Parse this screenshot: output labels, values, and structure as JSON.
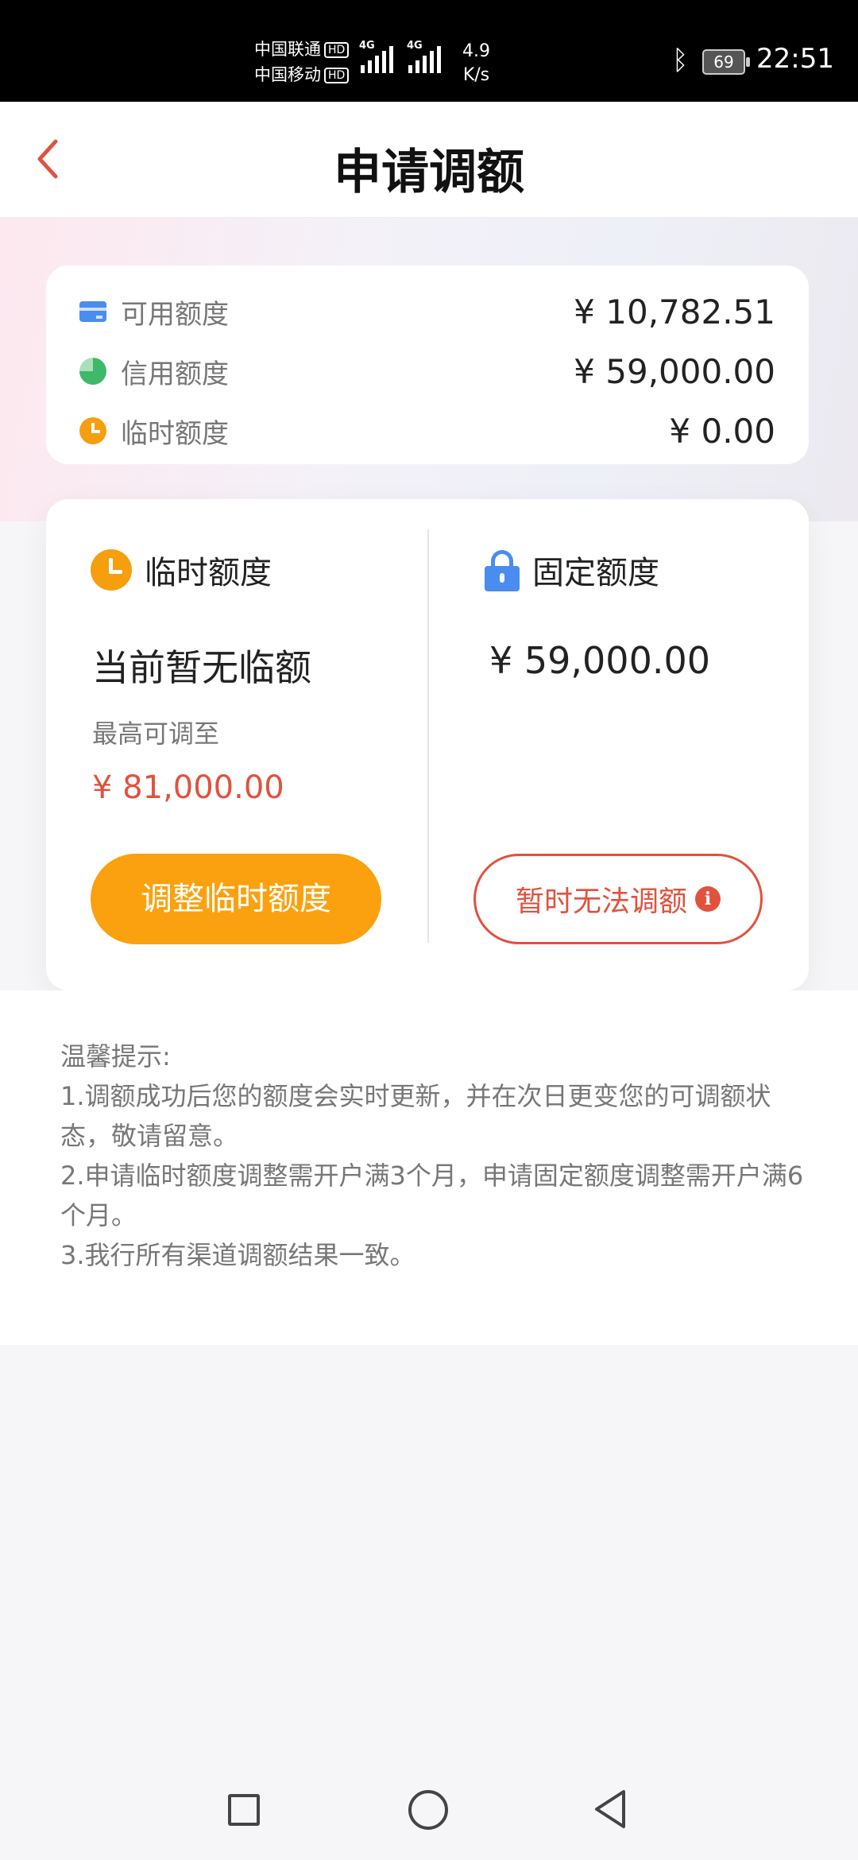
{
  "status_bar": {
    "carrier1": "中国联通",
    "carrier2": "中国移动",
    "hd": "HD",
    "network": "4G",
    "speed_value": "4.9",
    "speed_unit": "K/s",
    "battery": "69",
    "time": "22:51"
  },
  "header": {
    "title": "申请调额"
  },
  "summary": {
    "rows": [
      {
        "label": "可用额度",
        "value": "¥ 10,782.51",
        "icon": "card-icon"
      },
      {
        "label": "信用额度",
        "value": "¥ 59,000.00",
        "icon": "pie-chart-icon"
      },
      {
        "label": "临时额度",
        "value": "¥ 0.00",
        "icon": "clock-icon"
      }
    ]
  },
  "temp": {
    "heading": "临时额度",
    "status": "当前暂无临额",
    "max_label": "最高可调至",
    "max_value": "¥ 81,000.00",
    "button": "调整临时额度"
  },
  "fixed": {
    "heading": "固定额度",
    "amount": "¥ 59,000.00",
    "button": "暂时无法调额",
    "info": "i"
  },
  "tips": {
    "title": "温馨提示:",
    "items": [
      "1.调额成功后您的额度会实时更新，并在次日更变您的可调额状态，敬请留意。",
      "2.申请临时额度调整需开户满3个月，申请固定额度调整需开户满6个月。",
      "3.我行所有渠道调额结果一致。"
    ]
  },
  "colors": {
    "accent": "#e0523e",
    "orange": "#fba10f",
    "blue": "#4a8cf0"
  }
}
